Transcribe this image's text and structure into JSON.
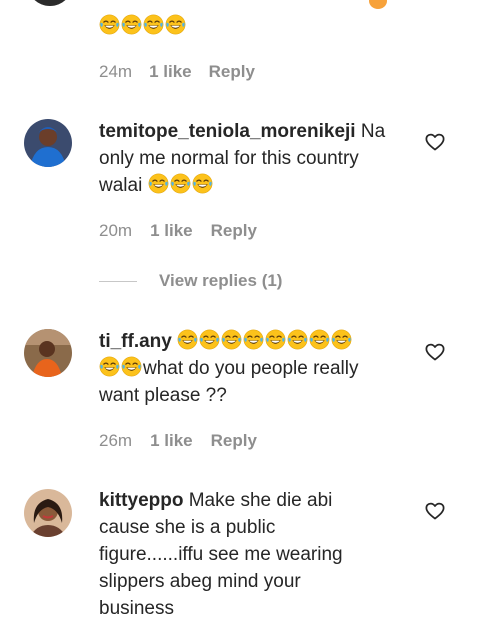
{
  "top_comment": {
    "meta": {
      "time": "24m",
      "likes": "1 like",
      "reply": "Reply"
    }
  },
  "comments": [
    {
      "username": "temitope_teniola_morenikeji",
      "text_line1": "Na",
      "text_line2": "only me normal for this country",
      "text_line3": "walai",
      "meta": {
        "time": "20m",
        "likes": "1 like",
        "reply": "Reply"
      },
      "view_replies": "View replies (1)"
    },
    {
      "username": "ti_ff.any",
      "text_line2": "what do you people really",
      "text_line3": "want please ??",
      "meta": {
        "time": "26m",
        "likes": "1 like",
        "reply": "Reply"
      }
    },
    {
      "username": "kittyeppo",
      "text_line1": "Make she die abi",
      "text_line2": "cause she is a public",
      "text_line3": "figure......iffu see me wearing",
      "text_line4": "slippers abeg mind your",
      "text_line5": "business"
    }
  ],
  "icons": {
    "emoji": "face-with-tears-of-joy",
    "like": "heart-outline-icon"
  },
  "colors": {
    "text": "#262626",
    "muted": "#8e8e8e",
    "emoji_face": "#fcc21b"
  }
}
